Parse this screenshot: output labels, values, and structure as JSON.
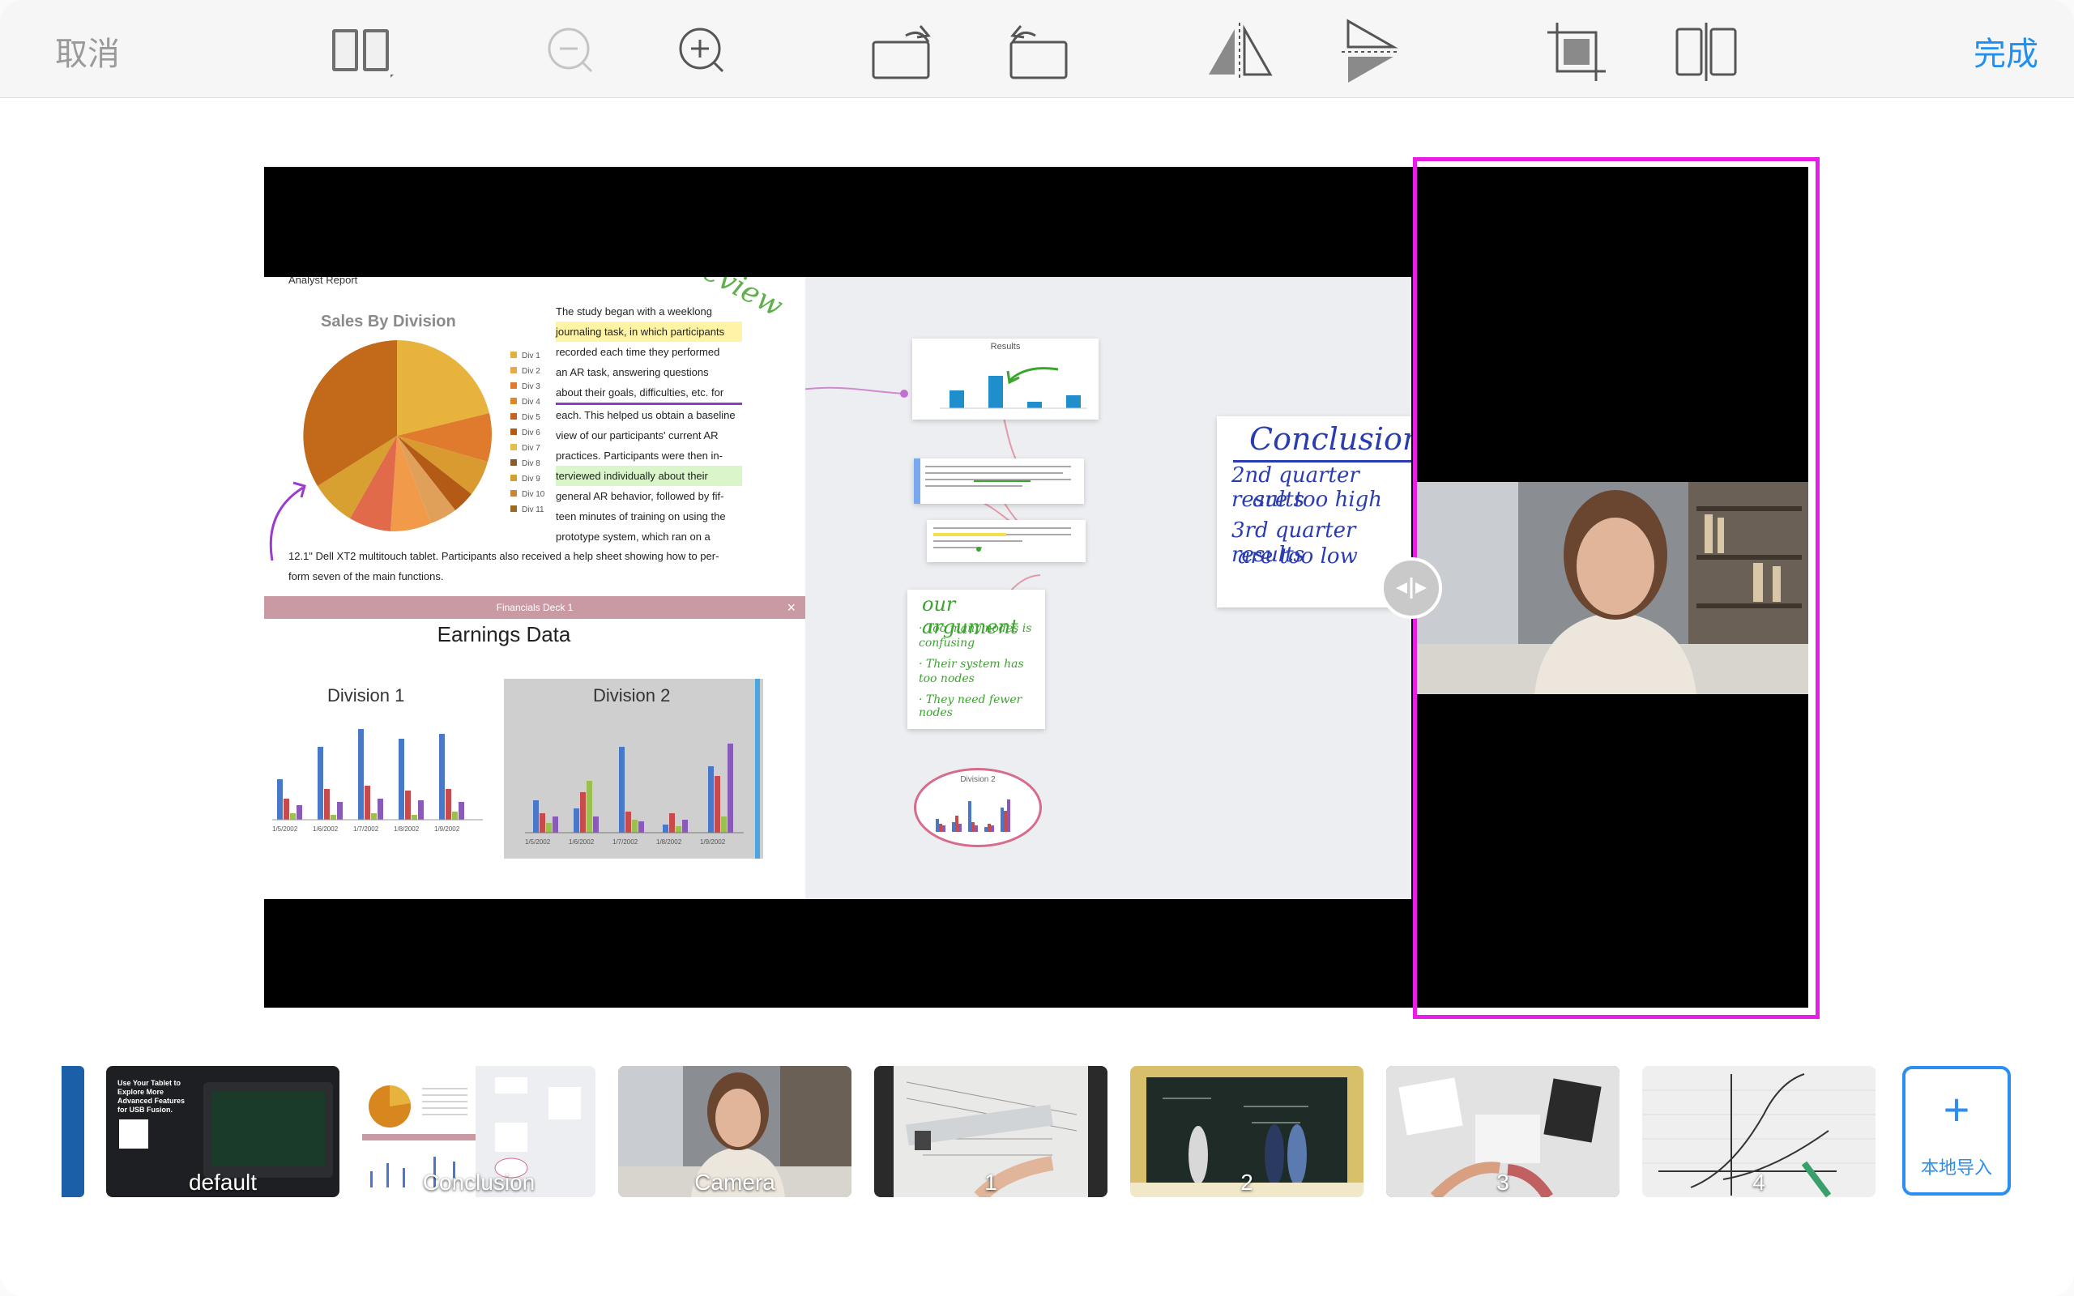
{
  "toolbar": {
    "cancel_label": "取消",
    "done_label": "完成"
  },
  "doc": {
    "header": "Analyst Report",
    "pie_title": "Sales By Division",
    "legend": [
      "Div 1",
      "Div 2",
      "Div 3",
      "Div 4",
      "Div 5",
      "Div 6",
      "Div 7",
      "Div 8",
      "Div 9",
      "Div 10",
      "Div 11"
    ],
    "legend_colors": [
      "#e2b13b",
      "#e8a64a",
      "#e07a2c",
      "#d98a2a",
      "#c6621e",
      "#b35a17",
      "#e0c04a",
      "#8a5a2a",
      "#d0a030",
      "#c8843a",
      "#9a6a20"
    ],
    "study_lines": [
      "The study began with a weeklong",
      "journaling task, in which participants",
      "recorded each time they performed",
      "an AR task, answering questions",
      "about their goals, difficulties, etc. for",
      "each. This helped us obtain a baseline",
      "view of our participants' current AR",
      "practices. Participants were then in-",
      "terviewed individually about their",
      "general AR behavior, followed by fif-",
      "teen minutes of training on using the",
      "prototype system, which ran on a"
    ],
    "study_tail_1": "12.1\" Dell XT2 multitouch tablet. Participants also received a help sheet showing how to per-",
    "study_tail_2": "form seven of the main functions.",
    "review_word": "review",
    "fin_bar_title": "Financials Deck 1",
    "earnings_title": "Earnings Data",
    "div1_title": "Division 1",
    "div2_title": "Division 2",
    "dates": [
      "1/5/2002",
      "1/6/2002",
      "1/7/2002",
      "1/8/2002",
      "1/9/2002"
    ]
  },
  "canvas": {
    "results_title": "Results",
    "division2_title": "Division 2",
    "conclusion_title": "Conclusion",
    "conclusion_lines": [
      "2nd quarter results",
      "are too high",
      "3rd quarter results",
      "are too low"
    ],
    "argument_title": "our argument",
    "argument_lines": [
      "· Too many nodes is",
      "  confusing",
      "· Their system has",
      "  too nodes",
      "· They need fewer nodes"
    ]
  },
  "thumbnails": [
    {
      "label": "default"
    },
    {
      "label": "Conclusion"
    },
    {
      "label": "Camera"
    },
    {
      "label": "1"
    },
    {
      "label": "2"
    },
    {
      "label": "3"
    },
    {
      "label": "4"
    }
  ],
  "default_thumb_text": "Use Your Tablet to Explore More Advanced Features for USB Fusion.",
  "import_label": "本地导入",
  "colors": {
    "accent": "#1f8ff0",
    "selection": "#e61ee6"
  },
  "icons": [
    "layout-icon",
    "zoom-out-icon",
    "zoom-in-icon",
    "rotate-left-icon",
    "rotate-right-icon",
    "flip-horizontal-icon",
    "flip-vertical-icon",
    "crop-icon",
    "split-icon"
  ]
}
